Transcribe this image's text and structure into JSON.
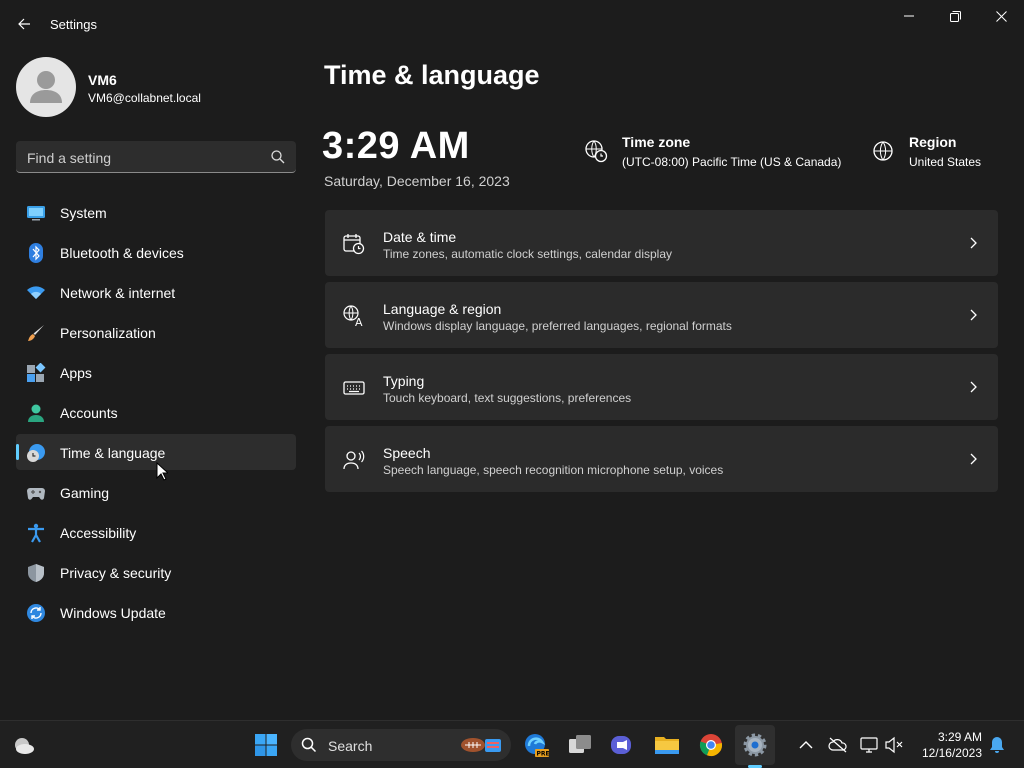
{
  "window": {
    "app_title": "Settings",
    "back_icon": "back-arrow-icon",
    "controls": [
      "minimize-icon",
      "maximize-icon",
      "close-icon"
    ]
  },
  "profile": {
    "name": "VM6",
    "email": "VM6@collabnet.local"
  },
  "search": {
    "placeholder": "Find a setting",
    "icon": "search-icon"
  },
  "sidebar": {
    "active_index": 6,
    "accent_color": "#60cdff",
    "items": [
      {
        "label": "System",
        "icon": "system-icon"
      },
      {
        "label": "Bluetooth & devices",
        "icon": "bluetooth-icon"
      },
      {
        "label": "Network & internet",
        "icon": "wifi-icon"
      },
      {
        "label": "Personalization",
        "icon": "brush-icon"
      },
      {
        "label": "Apps",
        "icon": "apps-icon"
      },
      {
        "label": "Accounts",
        "icon": "accounts-icon"
      },
      {
        "label": "Time & language",
        "icon": "time-language-icon"
      },
      {
        "label": "Gaming",
        "icon": "gamepad-icon"
      },
      {
        "label": "Accessibility",
        "icon": "accessibility-icon"
      },
      {
        "label": "Privacy & security",
        "icon": "shield-icon"
      },
      {
        "label": "Windows Update",
        "icon": "update-icon"
      }
    ]
  },
  "main": {
    "title": "Time & language",
    "time": "3:29 AM",
    "date": "Saturday, December 16, 2023",
    "timezone": {
      "title": "Time zone",
      "value": "(UTC-08:00) Pacific Time (US & Canada)",
      "icon": "timezone-globe-icon"
    },
    "region": {
      "title": "Region",
      "value": "United States",
      "icon": "globe-icon"
    },
    "cards": [
      {
        "title": "Date & time",
        "desc": "Time zones, automatic clock settings, calendar display",
        "icon": "calendar-clock-icon"
      },
      {
        "title": "Language & region",
        "desc": "Windows display language, preferred languages, regional formats",
        "icon": "language-icon"
      },
      {
        "title": "Typing",
        "desc": "Touch keyboard, text suggestions, preferences",
        "icon": "keyboard-icon"
      },
      {
        "title": "Speech",
        "desc": "Speech language, speech recognition microphone setup, voices",
        "icon": "speech-icon"
      }
    ]
  },
  "taskbar": {
    "search_label": "Search",
    "pinned": [
      "start-icon",
      "edge-beta-icon",
      "task-view-icon",
      "teams-icon",
      "file-explorer-icon",
      "chrome-icon",
      "settings-icon"
    ],
    "tray": [
      "chevron-up-icon",
      "onedrive-icon",
      "network-icon",
      "volume-muted-icon",
      "notification-bell-icon"
    ],
    "time": "3:29 AM",
    "date": "12/16/2023"
  }
}
